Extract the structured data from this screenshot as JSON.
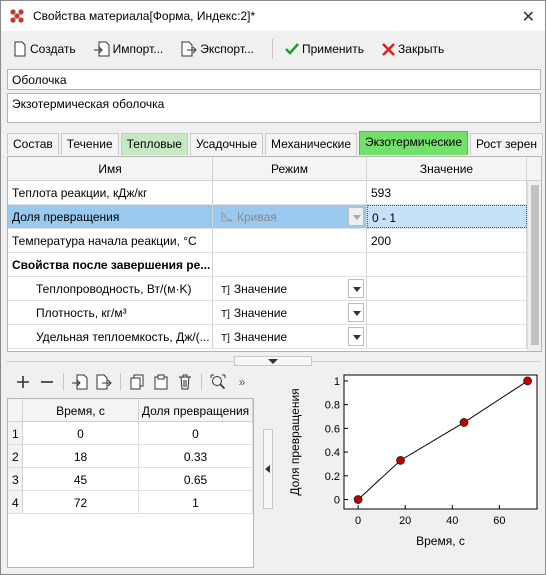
{
  "window": {
    "title": "Свойства материала[Форма, Индекс:2]*",
    "app_icon": "material-properties-icon"
  },
  "toolbar": {
    "create": "Создать",
    "import": "Импорт...",
    "export": "Экспорт...",
    "apply": "Применить",
    "close": "Закрыть"
  },
  "material": {
    "name": "Оболочка",
    "description": "Экзотермическая оболочка"
  },
  "tabs": [
    "Состав",
    "Течение",
    "Тепловые",
    "Усадочные",
    "Механические",
    "Экзотермические",
    "Рост зерен"
  ],
  "tab_active": "Экзотермические",
  "grid": {
    "headers": [
      "Имя",
      "Режим",
      "Значение"
    ],
    "rows": [
      {
        "name": "Теплота реакции, кДж/кг",
        "mode": "",
        "value": "593"
      },
      {
        "name": "Доля превращения",
        "mode": "Кривая",
        "value": "0 - 1"
      },
      {
        "name": "Температура начала реакции, °C",
        "mode": "",
        "value": "200"
      },
      {
        "name": "Свойства после завершения ре...",
        "mode": "",
        "value": ""
      },
      {
        "name": "Теплопроводность, Вт/(м·K)",
        "mode": "Значение",
        "value": ""
      },
      {
        "name": "Плотность, кг/м³",
        "mode": "Значение",
        "value": ""
      },
      {
        "name": "Удельная теплоемкость, Дж/(...",
        "mode": "Значение",
        "value": ""
      }
    ]
  },
  "table": {
    "headers": [
      "Время, с",
      "Доля превращения"
    ],
    "rows": [
      {
        "n": "1",
        "t": "0",
        "f": "0"
      },
      {
        "n": "2",
        "t": "18",
        "f": "0.33"
      },
      {
        "n": "3",
        "t": "45",
        "f": "0.65"
      },
      {
        "n": "4",
        "t": "72",
        "f": "1"
      }
    ]
  },
  "chart_data": {
    "type": "line",
    "xlabel": "Время, с",
    "ylabel": "Доля превращения",
    "x": [
      0,
      18,
      45,
      72
    ],
    "y": [
      0,
      0.33,
      0.65,
      1
    ],
    "xlim": [
      -6,
      76
    ],
    "ylim": [
      -0.08,
      1.05
    ],
    "xticks": [
      "0",
      "20",
      "40",
      "60"
    ],
    "yticks": [
      "0",
      "0.2",
      "0.4",
      "0.6",
      "0.8",
      "1"
    ],
    "grid": false,
    "marker_color": "#c00000",
    "line_color": "#000000"
  }
}
